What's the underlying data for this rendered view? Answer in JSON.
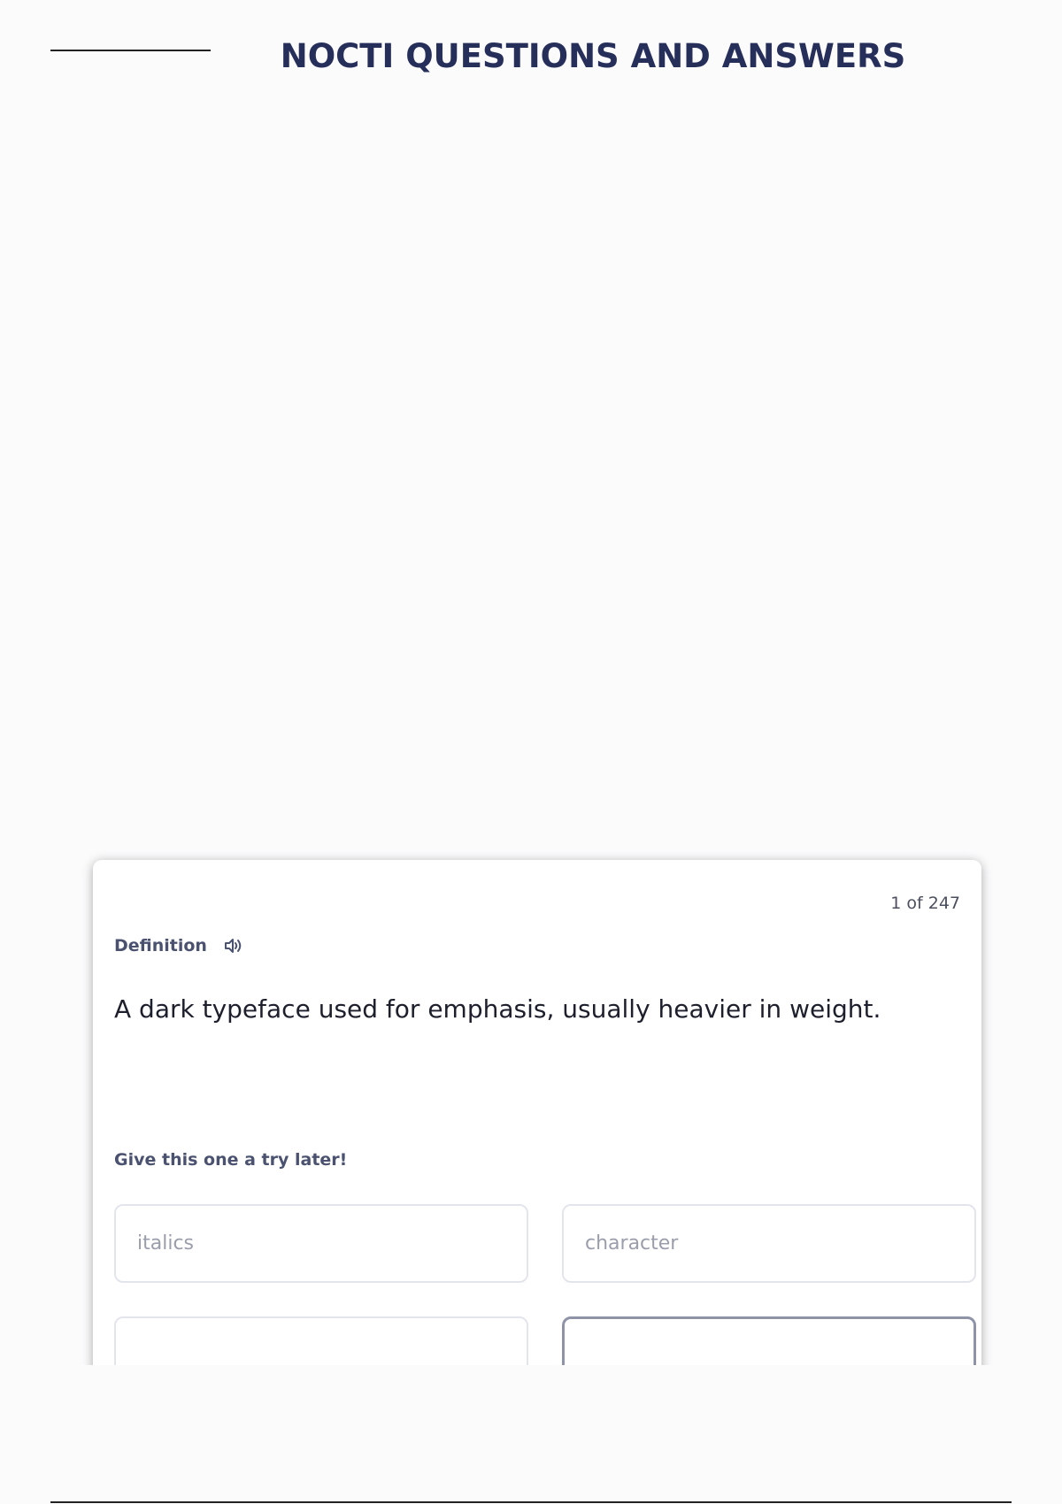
{
  "header": {
    "title": "NOCTI QUESTIONS AND ANSWERS"
  },
  "card": {
    "counter": "1 of 247",
    "term_label": "Definition",
    "definition": "A dark typeface used for emphasis, usually heavier in weight.",
    "hint": "Give this one a try later!",
    "options": [
      {
        "label": "italics"
      },
      {
        "label": "character"
      },
      {
        "label": ""
      },
      {
        "label": ""
      }
    ]
  },
  "icons": {
    "audio": "speaker-icon"
  },
  "colors": {
    "title": "#262e5a",
    "label": "#4a5270",
    "option_text": "#9a9dab"
  }
}
